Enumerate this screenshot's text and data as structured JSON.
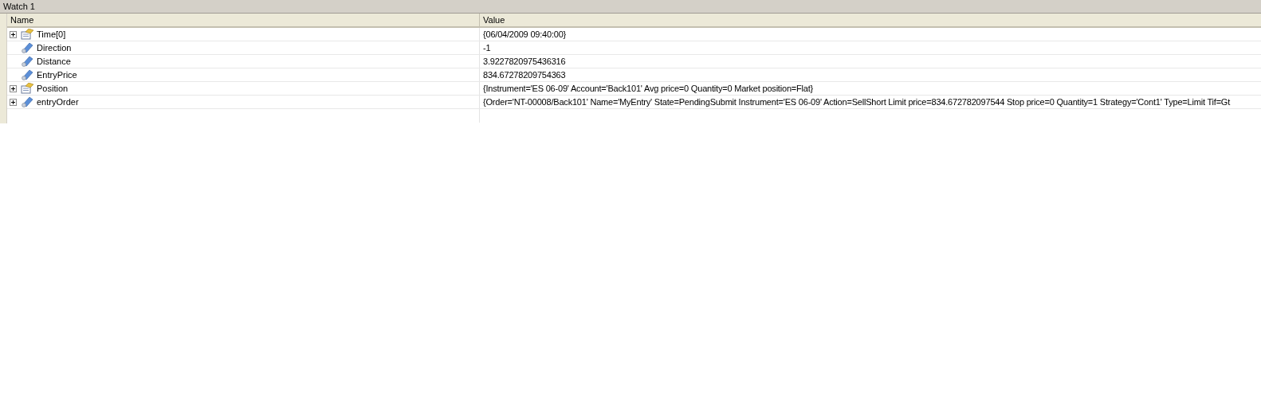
{
  "window": {
    "title": "Watch 1"
  },
  "table": {
    "columns": [
      "Name",
      "Value"
    ],
    "rows": [
      {
        "name": "Time[0]",
        "value": "{06/04/2009 09:40:00}",
        "kind": "object",
        "expandable": true
      },
      {
        "name": "Direction",
        "value": "-1",
        "kind": "field",
        "expandable": false
      },
      {
        "name": "Distance",
        "value": "3.9227820975436316",
        "kind": "field",
        "expandable": false
      },
      {
        "name": "EntryPrice",
        "value": "834.67278209754363",
        "kind": "field",
        "expandable": false
      },
      {
        "name": "Position",
        "value": "{Instrument='ES 06-09' Account='Back101' Avg price=0 Quantity=0 Market position=Flat}",
        "kind": "object",
        "expandable": true
      },
      {
        "name": "entryOrder",
        "value": "{Order='NT-00008/Back101' Name='MyEntry' State=PendingSubmit Instrument='ES 06-09' Action=SellShort Limit price=834.672782097544 Stop price=0 Quantity=1 Strategy='Cont1' Type=Limit Tif=Gt",
        "kind": "field",
        "expandable": true
      }
    ]
  }
}
